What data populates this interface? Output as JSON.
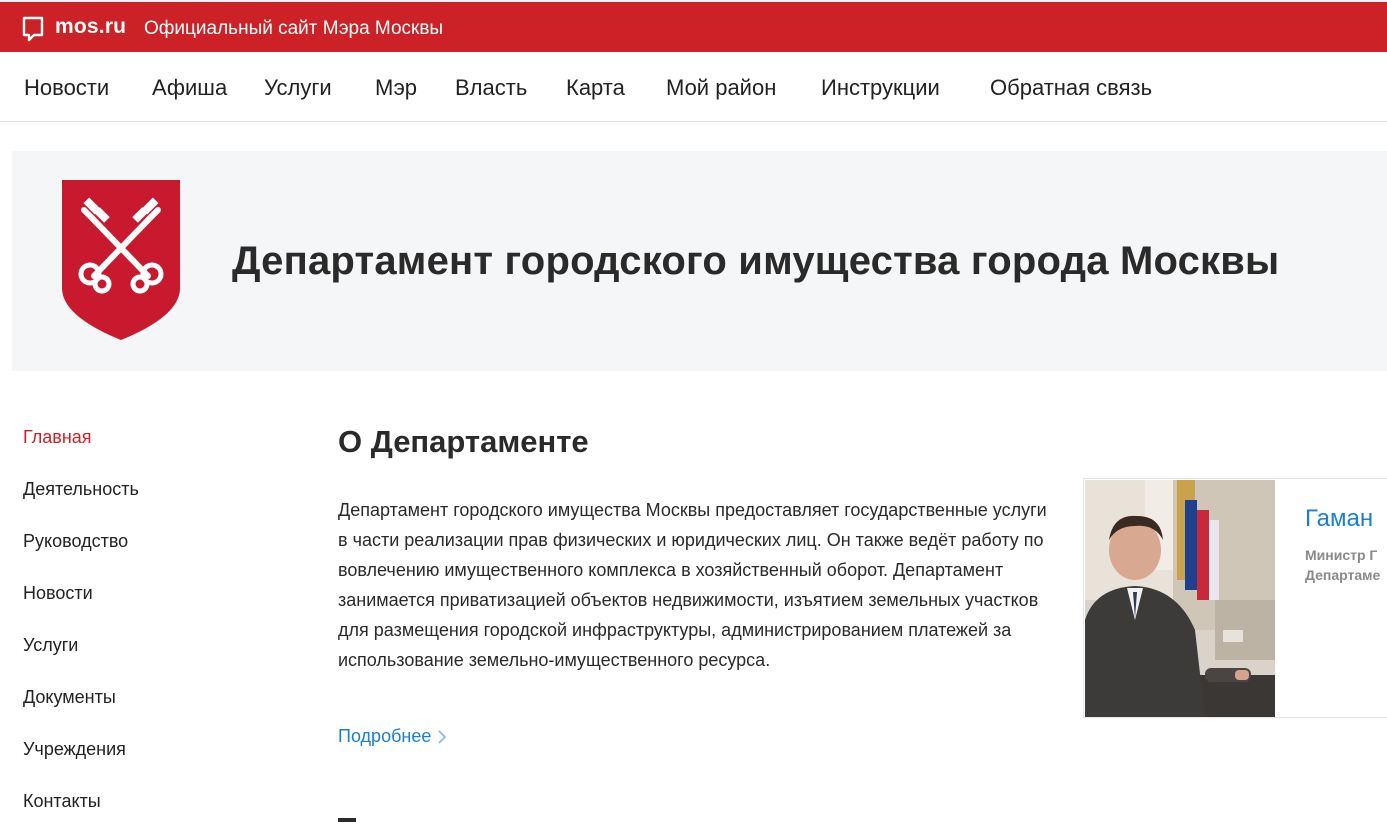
{
  "topbar": {
    "logo_text": "mos.ru",
    "site_title": "Официальный сайт Мэра Москвы",
    "background": "#cc2127"
  },
  "nav": {
    "items": [
      "Новости",
      "Афиша",
      "Услуги",
      "Мэр",
      "Власть",
      "Карта",
      "Мой район",
      "Инструкции",
      "Обратная связь"
    ]
  },
  "banner": {
    "title": "Департамент городского имущества города Москвы",
    "emblem_icon": "shield-crossed-keys-icon",
    "emblem_color": "#c8192e"
  },
  "sidebar": {
    "items": [
      {
        "label": "Главная",
        "active": true
      },
      {
        "label": "Деятельность"
      },
      {
        "label": "Руководство"
      },
      {
        "label": "Новости"
      },
      {
        "label": "Услуги"
      },
      {
        "label": "Документы"
      },
      {
        "label": "Учреждения"
      },
      {
        "label": "Контакты"
      }
    ]
  },
  "main": {
    "section_title": "О Департаменте",
    "about_text": "Департамент городского имущества Москвы предоставляет государственные услуги в части реализации прав физических и юридических лиц. Он также ведёт работу по вовлечению имущественного комплекса в хозяйственный оборот. Департамент занимается приватизацией объектов недвижимости, изъятием земельных участков для размещения городской инфраструктуры, администрированием платежей за использование земельно-имущественного ресурса.",
    "more_link": "Подробнее",
    "more_icon": "chevron-right-icon"
  },
  "minister": {
    "name": "Гаман",
    "role_line1": "Министр Г",
    "role_line2": "Департаме"
  },
  "colors": {
    "accent_red": "#cc2127",
    "link_blue": "#1a7fd4",
    "banner_bg": "#f5f6f8"
  }
}
